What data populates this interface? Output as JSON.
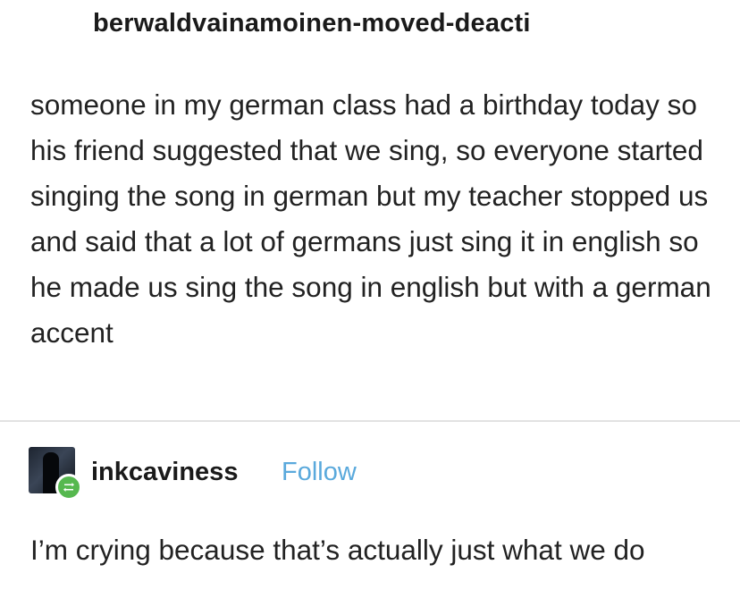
{
  "original_post": {
    "username": "berwaldvainamoinen-moved-deacti",
    "body": "someone in my german class had a birthday today so his friend suggested that we sing, so everyone started singing the song in german but my teacher stopped us and said that a lot of germans just sing it in english so he made us sing the song in english but with a german accent"
  },
  "reblog": {
    "username": "inkcaviness",
    "follow_label": "Follow",
    "avatar_icon": "avatar-image",
    "badge_icon": "reblog-icon",
    "badge_color": "#56b84f",
    "follow_color": "#5aa9dc",
    "body": "I’m crying because that’s actually just what we do"
  }
}
